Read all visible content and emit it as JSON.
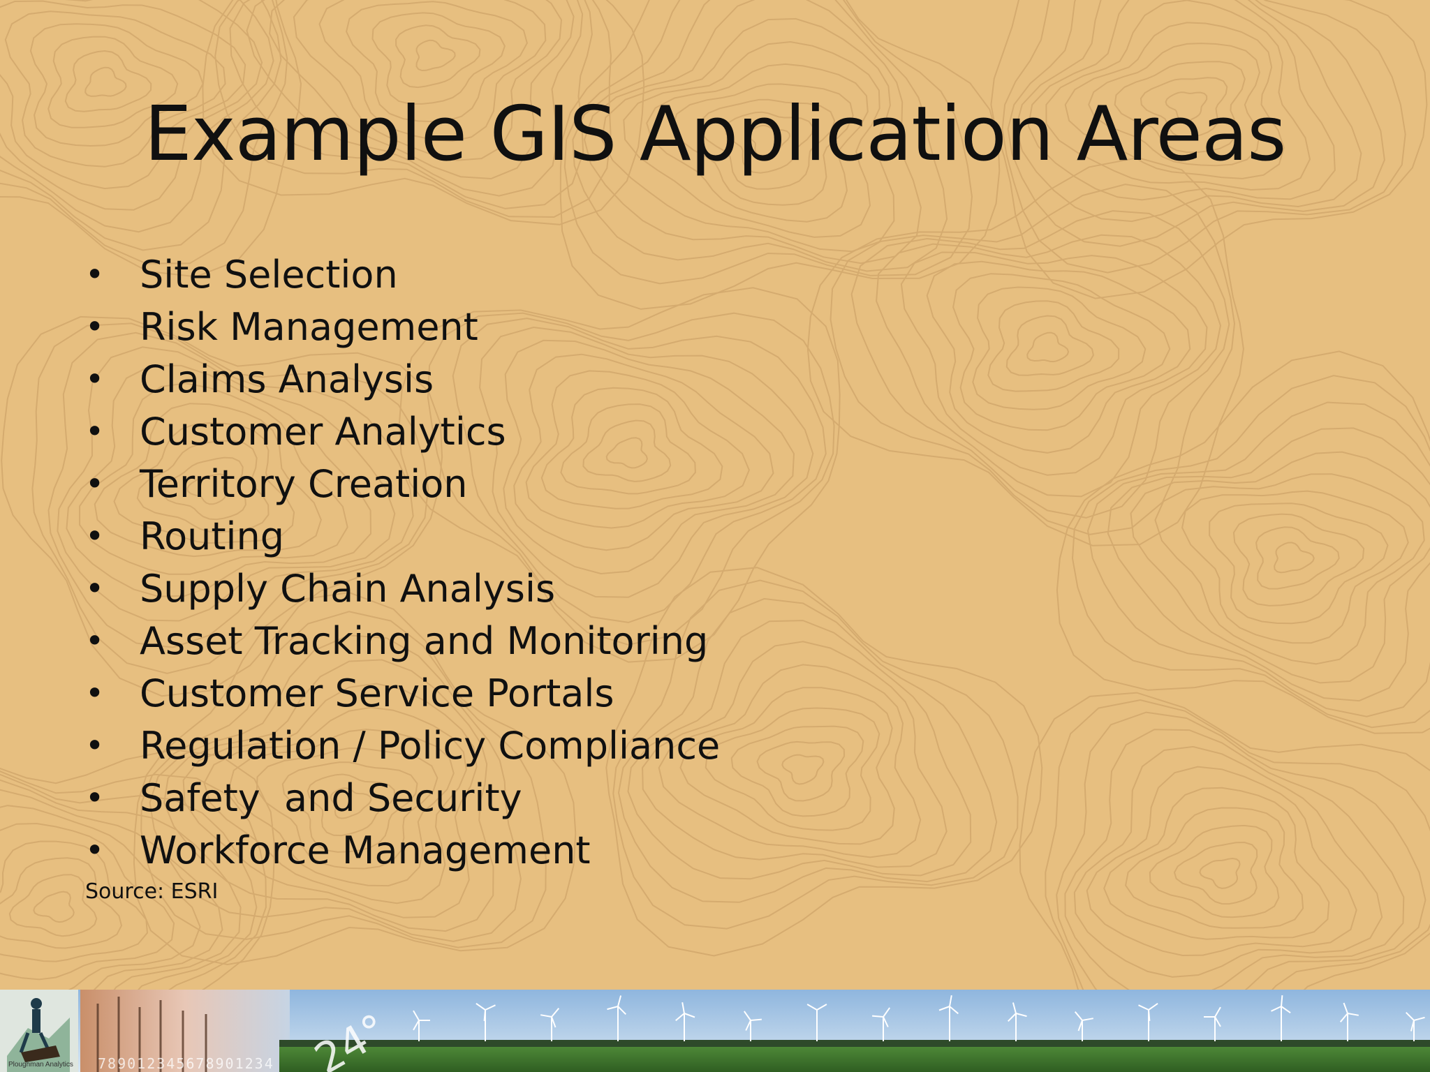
{
  "slide": {
    "title": "Example GIS Application Areas",
    "bullet_glyph": "•",
    "bullets": [
      "Site Selection",
      "Risk Management",
      "Claims Analysis",
      "Customer Analytics",
      "Territory Creation",
      "Routing",
      "Supply Chain Analysis",
      "Asset Tracking and Monitoring",
      "Customer Service Portals",
      "Regulation / Policy Compliance",
      "Safety  and Security",
      "Workforce Management"
    ],
    "source": "Source: ESRI"
  },
  "banner": {
    "logo_caption": "Ploughman Analytics",
    "numbers_text": "789012345678901234"
  },
  "colors": {
    "background": "#e7bf80",
    "text": "#101010",
    "contour": "#c9a064",
    "sky": "#a9c8e6",
    "field": "#3f7a2e"
  }
}
